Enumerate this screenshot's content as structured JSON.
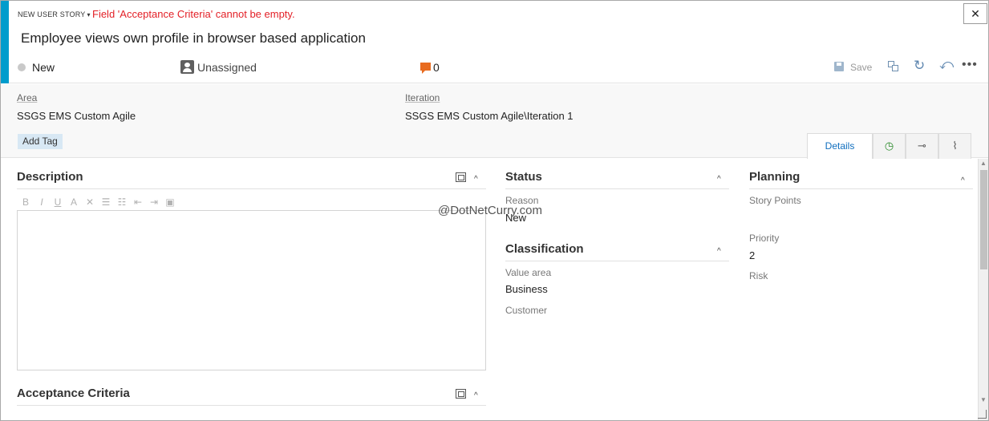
{
  "header": {
    "work_item_type": "NEW USER STORY",
    "type_caret": "▾",
    "error": "Field 'Acceptance Criteria' cannot be empty.",
    "close": "✕",
    "title": "Employee views own profile in browser based application",
    "state": "New",
    "assigned_to": "Unassigned",
    "comment_count": "0",
    "save_label": "Save",
    "more": "•••",
    "refresh": "↻",
    "undo": "⤺"
  },
  "meta": {
    "area_label": "Area",
    "area_value": "SSGS EMS Custom Agile",
    "iteration_label": "Iteration",
    "iteration_value": "SSGS EMS Custom Agile\\Iteration 1",
    "add_tag": "Add Tag"
  },
  "tabs": {
    "details": "Details",
    "history": "◷",
    "links": "⊸",
    "attachments": "⌇"
  },
  "description": {
    "title": "Description",
    "toolbar": [
      "B",
      "I",
      "U",
      "A",
      "✕",
      "☰",
      "☷",
      "⇤",
      "⇥",
      "▣"
    ]
  },
  "acceptance": {
    "title": "Acceptance Criteria"
  },
  "status": {
    "title": "Status",
    "reason_label": "Reason",
    "reason_value": "New"
  },
  "classification": {
    "title": "Classification",
    "value_area_label": "Value area",
    "value_area_value": "Business",
    "customer_label": "Customer"
  },
  "planning": {
    "title": "Planning",
    "story_points_label": "Story Points",
    "priority_label": "Priority",
    "priority_value": "2",
    "risk_label": "Risk"
  },
  "watermark": "@DotNetCurry.com",
  "colors": {
    "accent": "#009ccc",
    "error": "#e31f26",
    "comment": "#e86b1f",
    "tab_active": "#106ebe"
  }
}
